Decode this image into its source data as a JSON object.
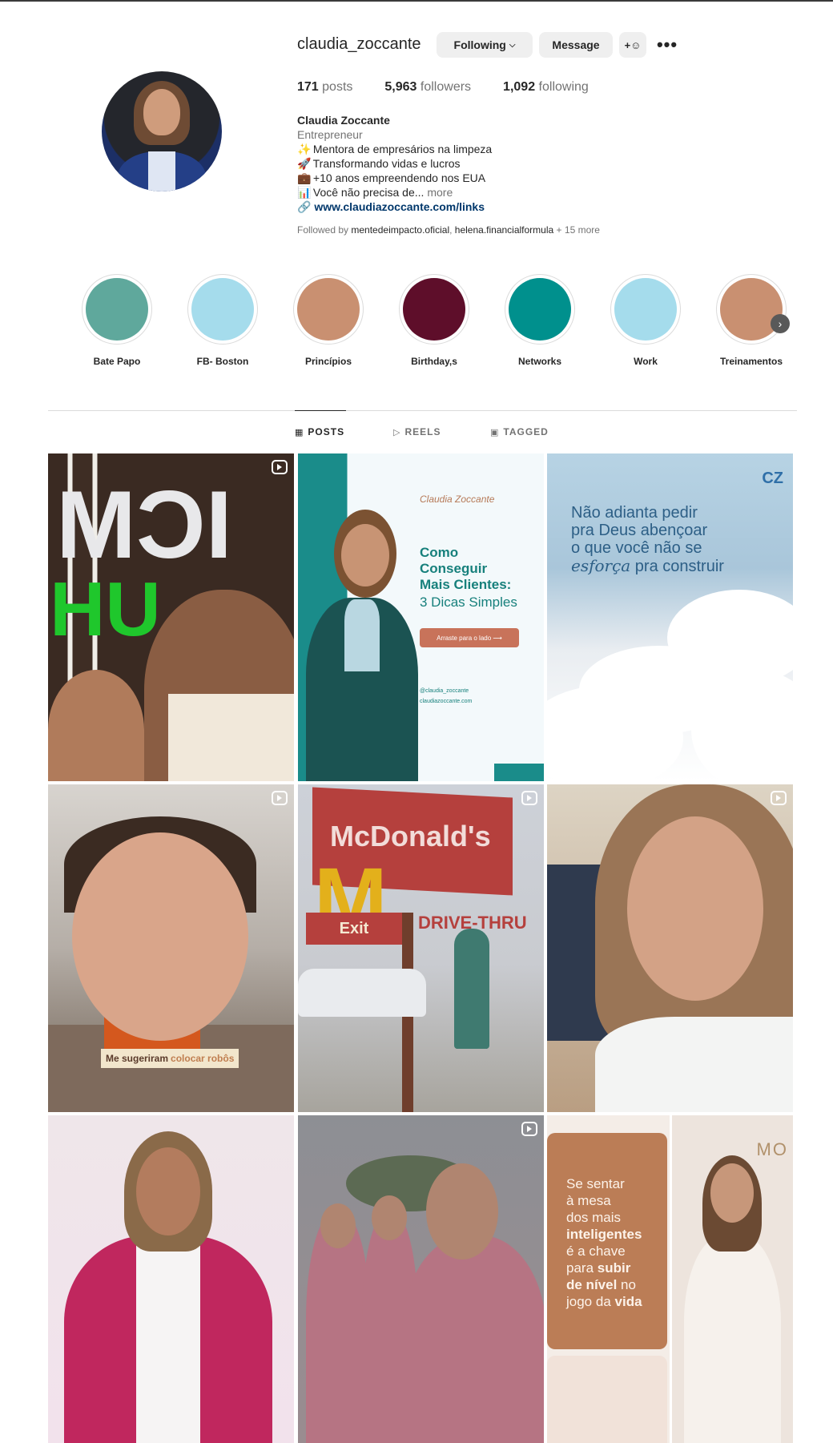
{
  "profile": {
    "username": "claudia_zoccante",
    "following_button": "Following",
    "message_button": "Message",
    "add_user_icon": "add-user-icon",
    "more_icon": "more-options-icon",
    "stats": {
      "posts_count": "171",
      "posts_label": "posts",
      "followers_count": "5,963",
      "followers_label": "followers",
      "following_count": "1,092",
      "following_label": "following"
    },
    "full_name": "Claudia Zoccante",
    "category": "Entrepreneur",
    "bio": [
      {
        "emoji": "✨",
        "text": "Mentora de empresários na limpeza"
      },
      {
        "emoji": "🚀",
        "text": "Transformando vidas e lucros"
      },
      {
        "emoji": "💼",
        "text": "+10 anos empreendendo nos EUA"
      },
      {
        "emoji": "📊",
        "text": "Você não precisa de..."
      }
    ],
    "bio_more": "more",
    "link": "www.claudiazoccante.com/links",
    "followed_by": {
      "prefix": "Followed by",
      "accounts": [
        "mentedeimpacto.oficial",
        "helena.financialformula"
      ],
      "more": "+ 15 more"
    }
  },
  "highlights": [
    {
      "label": "Bate Papo",
      "color": "#5fa89c"
    },
    {
      "label": "FB- Boston",
      "color": "#a5dcec"
    },
    {
      "label": "Princípios",
      "color": "#c99071"
    },
    {
      "label": "Birthday,s",
      "color": "#5e0e2a"
    },
    {
      "label": "Networks",
      "color": "#00908d"
    },
    {
      "label": "Work",
      "color": "#a5dcec"
    },
    {
      "label": "Treinamentos",
      "color": "#c99071"
    }
  ],
  "tabs": [
    {
      "label": "POSTS",
      "icon": "grid-icon",
      "active": true
    },
    {
      "label": "REELS",
      "icon": "reels-icon",
      "active": false
    },
    {
      "label": "TAGGED",
      "icon": "tagged-icon",
      "active": false
    }
  ],
  "posts": {
    "post2": {
      "brand": "Claudia Zoccante",
      "headline_1": "Como",
      "headline_2": "Conseguir",
      "headline_3": "Mais Clientes:",
      "subheadline": "3 Dicas Simples",
      "cta": "Arraste para o lado ⟶",
      "handle": "@claudia_zoccante",
      "site": "claudiazoccante.com"
    },
    "post3": {
      "logo": "CZ",
      "line1": "Não adianta pedir",
      "line2": "pra Deus abençoar",
      "line3": "o que você não se",
      "line4_italic": "esforça",
      "line4_rest": " pra construir"
    },
    "post4": {
      "caption_a": "Me sugeriram",
      "caption_b": "colocar robôs"
    },
    "post5": {
      "sign": "McDonald's",
      "exit": "Exit",
      "drive": "DRIVE-THRU"
    },
    "post9": {
      "t1": "Se sentar",
      "t2": "à mesa",
      "t3": "dos mais",
      "t4": "inteligentes",
      "t5": "é a chave",
      "t6": "para",
      "t7": "subir",
      "t8": "de nível",
      "t9": "no",
      "t10": "jogo da",
      "t11": "vida"
    },
    "post10": {
      "sign": "MO"
    }
  }
}
